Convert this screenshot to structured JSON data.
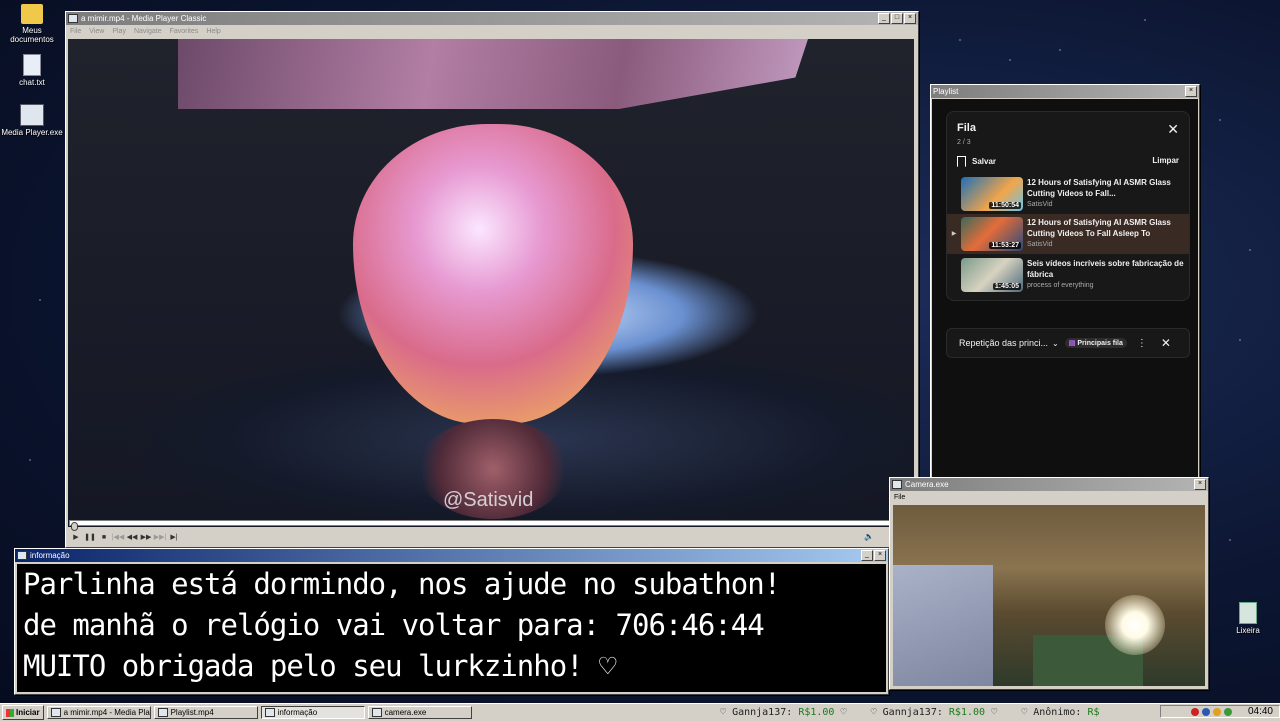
{
  "desktop": {
    "icons": [
      {
        "label": "Meus documentos"
      },
      {
        "label": "chat.txt"
      },
      {
        "label": "Media Player.exe"
      },
      {
        "label": "Lixeira"
      }
    ]
  },
  "media_player": {
    "title": "a mimir.mp4 - Media Player Classic",
    "menu": [
      "File",
      "View",
      "Play",
      "Navigate",
      "Favorites",
      "Help"
    ],
    "watermark": "@Satisvid",
    "controls": [
      "▶",
      "❚❚",
      "■",
      "|◀◀",
      "◀◀",
      "▶▶",
      "▶▶|",
      "▶|"
    ]
  },
  "playlist_window": {
    "title": "Playlist",
    "queue": {
      "title": "Fila",
      "count": "2 / 3",
      "save_label": "Salvar",
      "clear_label": "Limpar",
      "close_icon": "✕",
      "items": [
        {
          "title": "12 Hours of Satisfying AI ASMR Glass Cutting Videos to Fall...",
          "channel": "SatisVid",
          "duration": "11:50:54",
          "current": false
        },
        {
          "title": "12 Hours of Satisfying AI ASMR Glass Cutting Videos To Fall Asleep To",
          "channel": "SatisVid",
          "duration": "11:53:27",
          "current": true
        },
        {
          "title": "Seis vídeos incríveis sobre fabricação de fábrica",
          "channel": "process of everything",
          "duration": "1:45:05",
          "current": false
        }
      ]
    },
    "loop_bar": {
      "label": "Repetição das princi...",
      "chip": "Principais fila"
    }
  },
  "info_window": {
    "title": "informação",
    "lines": [
      "Parlinha está dormindo, nos ajude no subathon!",
      "de manhã o relógio vai voltar para:  706:46:44",
      "MUITO obrigada pelo seu lurkzinho! ♡"
    ]
  },
  "camera_window": {
    "title": "Camera.exe",
    "menu": [
      "File"
    ]
  },
  "taskbar": {
    "start_label": "Iniciar",
    "tasks": [
      {
        "label": "a mimir.mp4 - Media Player...",
        "active": false
      },
      {
        "label": "Playlist.mp4",
        "active": false
      },
      {
        "label": "informação",
        "active": true
      },
      {
        "label": "camera.exe",
        "active": false
      }
    ],
    "ticker": [
      {
        "name": "Gannja137:",
        "amount": "R$1.00"
      },
      {
        "name": "Gannja137:",
        "amount": "R$1.00"
      },
      {
        "name": "Anônimo:",
        "amount": "R$"
      }
    ],
    "clock": "04:40"
  }
}
